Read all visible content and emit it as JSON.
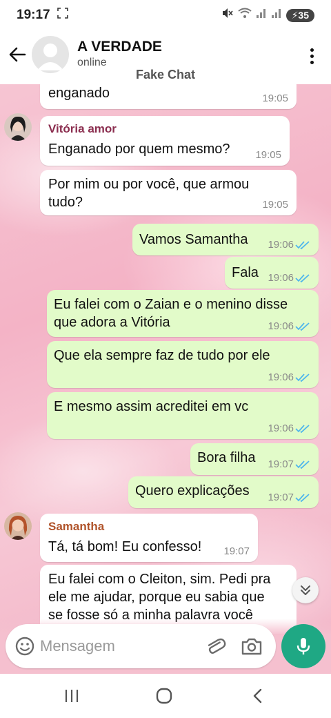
{
  "status_bar": {
    "time": "19:17",
    "battery": "35"
  },
  "header": {
    "contact_name": "A VERDADE",
    "contact_status": "online",
    "watermark": "Fake Chat"
  },
  "messages": [
    {
      "direction": "in",
      "text": "enganado",
      "time": "19:05"
    },
    {
      "direction": "in",
      "sender": "Vitória amor",
      "text": "Enganado por quem mesmo?",
      "time": "19:05"
    },
    {
      "direction": "in",
      "text_lines": [
        "Por mim ou por você, que armou",
        "tudo?"
      ],
      "time": "19:05"
    },
    {
      "direction": "out",
      "text": "Vamos Samantha",
      "time": "19:06"
    },
    {
      "direction": "out",
      "text": "Fala",
      "time": "19:06"
    },
    {
      "direction": "out",
      "text_lines": [
        "Eu falei com o Zaian e o menino disse",
        "que adora a Vitória"
      ],
      "time": "19:06"
    },
    {
      "direction": "out",
      "text": "Que ela sempre faz de tudo por ele",
      "time": "19:06"
    },
    {
      "direction": "out",
      "text": "E mesmo assim acreditei em vc",
      "time": "19:06"
    },
    {
      "direction": "out",
      "text": "Bora filha",
      "time": "19:07"
    },
    {
      "direction": "out",
      "text": "Quero explicações",
      "time": "19:07"
    },
    {
      "direction": "in",
      "sender": "Samantha",
      "text": "Tá, tá bom! Eu confesso!",
      "time": "19:07"
    },
    {
      "direction": "in",
      "text_lines": [
        "Eu falei com o Cleiton, sim. Pedi pra",
        "ele me ajudar, porque eu sabia que",
        "se fosse só a minha palavra você"
      ]
    }
  ],
  "input": {
    "placeholder": "Mensagem"
  },
  "colors": {
    "outgoing_bubble": "#e2fbc9",
    "incoming_bubble": "#ffffff",
    "accent_green": "#1fa884",
    "read_ticks": "#4fb6ec",
    "sender_vitoria": "#8b2e4f",
    "sender_samantha": "#b0532a"
  },
  "icons": [
    "back-arrow-icon",
    "more-vert-icon",
    "double-check-icon",
    "chevron-double-down-icon",
    "emoji-icon",
    "paperclip-icon",
    "camera-icon",
    "mic-icon",
    "nav-recents-icon",
    "nav-home-icon",
    "nav-back-icon"
  ]
}
